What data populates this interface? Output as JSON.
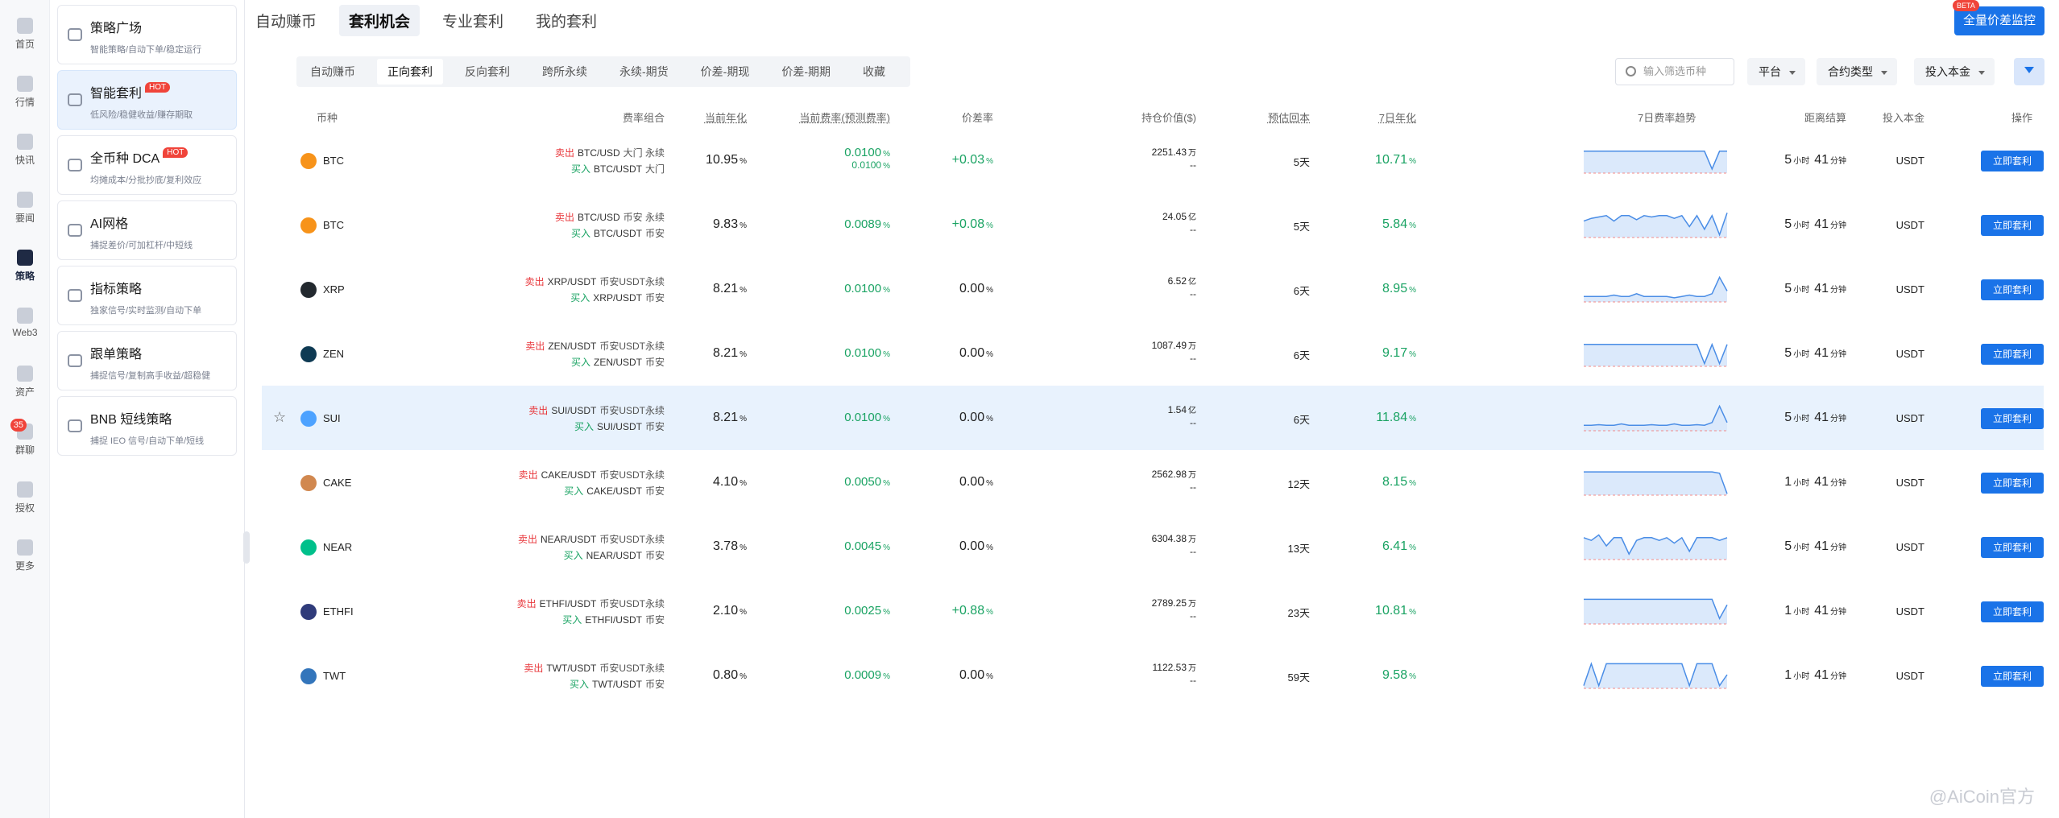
{
  "rail": [
    {
      "label": "首页",
      "icon": "home-icon"
    },
    {
      "label": "行情",
      "icon": "market-icon"
    },
    {
      "label": "快讯",
      "icon": "news-icon"
    },
    {
      "label": "要闻",
      "icon": "headline-icon"
    },
    {
      "label": "策略",
      "icon": "robot-icon",
      "active": true
    },
    {
      "label": "Web3",
      "icon": "web3-icon"
    },
    {
      "label": "资产",
      "icon": "asset-icon"
    },
    {
      "label": "群聊",
      "icon": "chat-icon",
      "badge": "35"
    },
    {
      "label": "授权",
      "icon": "auth-icon"
    },
    {
      "label": "更多",
      "icon": "more-icon"
    }
  ],
  "sidebar": [
    {
      "title": "策略广场",
      "sub": "智能策略/自动下单/稳定运行",
      "hot": "",
      "icon": "store-icon"
    },
    {
      "title": "智能套利",
      "sub": "低风险/稳健收益/赚存期取",
      "hot": "HOT",
      "icon": "arbitrage-icon",
      "active": true
    },
    {
      "title": "全币种 DCA",
      "sub": "均摊成本/分批抄底/复利效应",
      "hot": "HOT",
      "icon": "dca-icon"
    },
    {
      "title": "AI网格",
      "sub": "捕捉差价/可加杠杆/中短线",
      "hot": "",
      "icon": "grid-icon"
    },
    {
      "title": "指标策略",
      "sub": "独家信号/实时监测/自动下单",
      "hot": "",
      "icon": "indicator-icon"
    },
    {
      "title": "跟单策略",
      "sub": "捕捉信号/复制高手收益/超稳健",
      "hot": "",
      "icon": "copy-trade-icon"
    },
    {
      "title": "BNB 短线策略",
      "sub": "捕捉 IEO 信号/自动下单/短线",
      "hot": "",
      "icon": "bnb-icon"
    }
  ],
  "top_tabs": [
    "自动赚币",
    "套利机会",
    "专业套利",
    "我的套利"
  ],
  "top_active": 1,
  "monitor": {
    "label": "全量价差监控",
    "beta": "BETA"
  },
  "sub_tabs": [
    "自动赚币",
    "正向套利",
    "反向套利",
    "跨所永续",
    "永续-期货",
    "价差-期现",
    "价差-期期",
    "收藏"
  ],
  "sub_active": 1,
  "search": {
    "placeholder": "输入筛选币种"
  },
  "filters": {
    "platform": "平台",
    "contract": "合约类型",
    "invest": "投入本金"
  },
  "headers": {
    "coin": "币种",
    "combo": "费率组合",
    "annual": "当前年化",
    "rate": "当前费率(预测费率)",
    "spread": "价差率",
    "position": "持仓价值($)",
    "payback": "预估回本",
    "y7": "7日年化",
    "trend": "7日费率趋势",
    "settle": "距离结算",
    "invest": "投入本金",
    "action": "操作"
  },
  "labels": {
    "sell": "卖出",
    "buy": "买入",
    "hour": "小时",
    "minute": "分钟",
    "pct": "%",
    "go": "立即套利"
  },
  "colors": {
    "accent": "#1a73e8",
    "up": "#1aa363",
    "down": "#e8363a"
  },
  "rows": [
    {
      "coin": "BTC",
      "icon_color": "#f7931a",
      "sell_pair": "BTC/USD",
      "sell_ex": "大门 永续",
      "buy_pair": "BTC/USDT",
      "buy_ex": "大门",
      "annual": "10.95",
      "rate": "0.0100",
      "rate2": "0.0100",
      "spread": "+0.03",
      "pos": "2251.43",
      "pos_unit": "万",
      "pos2": "--",
      "payback": "5天",
      "y7": "10.71",
      "settle_h": "5",
      "settle_m": "41",
      "invest": "USDT",
      "trend": [
        0.2,
        0.2,
        0.2,
        0.2,
        0.2,
        0.2,
        0.2,
        0.2,
        0.2,
        0.2,
        0.2,
        0.2,
        0.2,
        0.2,
        0.2,
        0.2,
        0.2,
        0.85,
        0.2,
        0.2
      ]
    },
    {
      "coin": "BTC",
      "icon_color": "#f7931a",
      "sell_pair": "BTC/USD",
      "sell_ex": "币安 永续",
      "buy_pair": "BTC/USDT",
      "buy_ex": "币安",
      "annual": "9.83",
      "rate": "0.0089",
      "rate2": "",
      "spread": "+0.08",
      "pos": "24.05",
      "pos_unit": "亿",
      "pos2": "--",
      "payback": "5天",
      "y7": "5.84",
      "settle_h": "5",
      "settle_m": "41",
      "invest": "USDT",
      "trend": [
        0.4,
        0.3,
        0.25,
        0.2,
        0.4,
        0.2,
        0.2,
        0.35,
        0.2,
        0.25,
        0.2,
        0.2,
        0.3,
        0.2,
        0.6,
        0.2,
        0.7,
        0.2,
        0.9,
        0.1
      ]
    },
    {
      "coin": "XRP",
      "icon_color": "#23292f",
      "sell_pair": "XRP/USDT",
      "sell_ex": "币安USDT永续",
      "buy_pair": "XRP/USDT",
      "buy_ex": "币安",
      "annual": "8.21",
      "rate": "0.0100",
      "rate2": "",
      "spread": "0.00",
      "pos": "6.52",
      "pos_unit": "亿",
      "pos2": "--",
      "payback": "6天",
      "y7": "8.95",
      "settle_h": "5",
      "settle_m": "41",
      "invest": "USDT",
      "trend": [
        0.8,
        0.8,
        0.8,
        0.8,
        0.75,
        0.8,
        0.8,
        0.7,
        0.8,
        0.8,
        0.8,
        0.8,
        0.85,
        0.8,
        0.75,
        0.8,
        0.8,
        0.7,
        0.1,
        0.6
      ]
    },
    {
      "coin": "ZEN",
      "icon_color": "#0e3a53",
      "sell_pair": "ZEN/USDT",
      "sell_ex": "币安USDT永续",
      "buy_pair": "ZEN/USDT",
      "buy_ex": "币安",
      "annual": "8.21",
      "rate": "0.0100",
      "rate2": "",
      "spread": "0.00",
      "pos": "1087.49",
      "pos_unit": "万",
      "pos2": "--",
      "payback": "6天",
      "y7": "9.17",
      "settle_h": "5",
      "settle_m": "41",
      "invest": "USDT",
      "trend": [
        0.2,
        0.2,
        0.2,
        0.2,
        0.2,
        0.2,
        0.2,
        0.2,
        0.2,
        0.2,
        0.2,
        0.2,
        0.2,
        0.2,
        0.2,
        0.2,
        0.9,
        0.2,
        0.9,
        0.2
      ]
    },
    {
      "coin": "SUI",
      "icon_color": "#4da2ff",
      "sell_pair": "SUI/USDT",
      "sell_ex": "币安USDT永续",
      "buy_pair": "SUI/USDT",
      "buy_ex": "币安",
      "annual": "8.21",
      "rate": "0.0100",
      "rate2": "",
      "spread": "0.00",
      "pos": "1.54",
      "pos_unit": "亿",
      "pos2": "--",
      "payback": "6天",
      "y7": "11.84",
      "settle_h": "5",
      "settle_m": "41",
      "invest": "USDT",
      "highlight": true,
      "trend": [
        0.8,
        0.8,
        0.78,
        0.8,
        0.8,
        0.75,
        0.8,
        0.8,
        0.8,
        0.78,
        0.8,
        0.8,
        0.75,
        0.8,
        0.8,
        0.78,
        0.8,
        0.7,
        0.1,
        0.7
      ]
    },
    {
      "coin": "CAKE",
      "icon_color": "#d1884f",
      "sell_pair": "CAKE/USDT",
      "sell_ex": "币安USDT永续",
      "buy_pair": "CAKE/USDT",
      "buy_ex": "币安",
      "annual": "4.10",
      "rate": "0.0050",
      "rate2": "",
      "spread": "0.00",
      "pos": "2562.98",
      "pos_unit": "万",
      "pos2": "--",
      "payback": "12天",
      "y7": "8.15",
      "settle_h": "1",
      "settle_m": "41",
      "invest": "USDT",
      "trend": [
        0.15,
        0.15,
        0.15,
        0.15,
        0.15,
        0.15,
        0.15,
        0.15,
        0.15,
        0.15,
        0.15,
        0.15,
        0.15,
        0.15,
        0.15,
        0.15,
        0.15,
        0.15,
        0.2,
        0.95
      ]
    },
    {
      "coin": "NEAR",
      "icon_color": "#00c08b",
      "sell_pair": "NEAR/USDT",
      "sell_ex": "币安USDT永续",
      "buy_pair": "NEAR/USDT",
      "buy_ex": "币安",
      "annual": "3.78",
      "rate": "0.0045",
      "rate2": "",
      "spread": "0.00",
      "pos": "6304.38",
      "pos_unit": "万",
      "pos2": "--",
      "payback": "13天",
      "y7": "6.41",
      "settle_h": "5",
      "settle_m": "41",
      "invest": "USDT",
      "trend": [
        0.2,
        0.3,
        0.1,
        0.5,
        0.2,
        0.2,
        0.8,
        0.3,
        0.2,
        0.2,
        0.3,
        0.2,
        0.4,
        0.2,
        0.7,
        0.2,
        0.2,
        0.2,
        0.3,
        0.2
      ]
    },
    {
      "coin": "ETHFI",
      "icon_color": "#2f3b7a",
      "sell_pair": "ETHFI/USDT",
      "sell_ex": "币安USDT永续",
      "buy_pair": "ETHFI/USDT",
      "buy_ex": "币安",
      "annual": "2.10",
      "rate": "0.0025",
      "rate2": "",
      "spread": "+0.88",
      "pos": "2789.25",
      "pos_unit": "万",
      "pos2": "--",
      "payback": "23天",
      "y7": "10.81",
      "settle_h": "1",
      "settle_m": "41",
      "invest": "USDT",
      "trend": [
        0.1,
        0.1,
        0.1,
        0.1,
        0.1,
        0.1,
        0.1,
        0.1,
        0.1,
        0.1,
        0.1,
        0.1,
        0.1,
        0.1,
        0.1,
        0.1,
        0.1,
        0.1,
        0.8,
        0.3
      ]
    },
    {
      "coin": "TWT",
      "icon_color": "#3375bb",
      "sell_pair": "TWT/USDT",
      "sell_ex": "币安USDT永续",
      "buy_pair": "TWT/USDT",
      "buy_ex": "币安",
      "annual": "0.80",
      "rate": "0.0009",
      "rate2": "",
      "spread": "0.00",
      "pos": "1122.53",
      "pos_unit": "万",
      "pos2": "--",
      "payback": "59天",
      "y7": "9.58",
      "settle_h": "1",
      "settle_m": "41",
      "invest": "USDT",
      "trend": [
        0.9,
        0.1,
        0.9,
        0.1,
        0.1,
        0.1,
        0.1,
        0.1,
        0.1,
        0.1,
        0.1,
        0.1,
        0.1,
        0.1,
        0.9,
        0.1,
        0.1,
        0.1,
        0.9,
        0.5
      ]
    }
  ],
  "watermark": "@AiCoin官方"
}
